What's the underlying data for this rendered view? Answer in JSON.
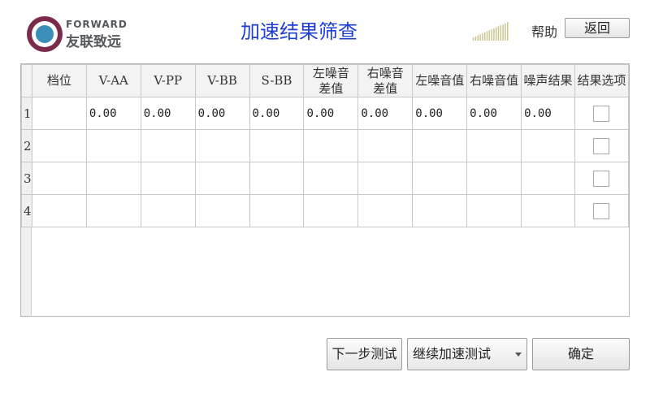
{
  "logo": {
    "brand_en": "FORWARD",
    "brand_cn": "友联致远"
  },
  "header": {
    "title": "加速结果筛查",
    "help_label": "帮助",
    "back_label": "返回",
    "signal_icon": "signal-strength-icon"
  },
  "table": {
    "columns": [
      "档位",
      "V-AA",
      "V-PP",
      "V-BB",
      "S-BB",
      "左噪音\n差值",
      "右噪音\n差值",
      "左噪音值",
      "右噪音值",
      "噪声结果",
      "结果选项"
    ],
    "columns_line1": [
      "档位",
      "V-AA",
      "V-PP",
      "V-BB",
      "S-BB",
      "左噪音",
      "右噪音",
      "左噪音值",
      "右噪音值",
      "噪声结果",
      "结果选项"
    ],
    "columns_line2": [
      "",
      "",
      "",
      "",
      "",
      "差值",
      "差值",
      "",
      "",
      "",
      ""
    ],
    "rows": [
      {
        "num": "1",
        "values": [
          "",
          "0.00",
          "0.00",
          "0.00",
          "0.00",
          "0.00",
          "0.00",
          "0.00",
          "0.00",
          "0.00"
        ],
        "checked": false
      },
      {
        "num": "2",
        "values": [
          "",
          "",
          "",
          "",
          "",
          "",
          "",
          "",
          "",
          ""
        ],
        "checked": false
      },
      {
        "num": "3",
        "values": [
          "",
          "",
          "",
          "",
          "",
          "",
          "",
          "",
          "",
          ""
        ],
        "checked": false
      },
      {
        "num": "4",
        "values": [
          "",
          "",
          "",
          "",
          "",
          "",
          "",
          "",
          "",
          ""
        ],
        "checked": false
      }
    ]
  },
  "controls": {
    "next_step_label": "下一步测试",
    "mode_select_value": "继续加速测试",
    "confirm_label": "确定"
  }
}
